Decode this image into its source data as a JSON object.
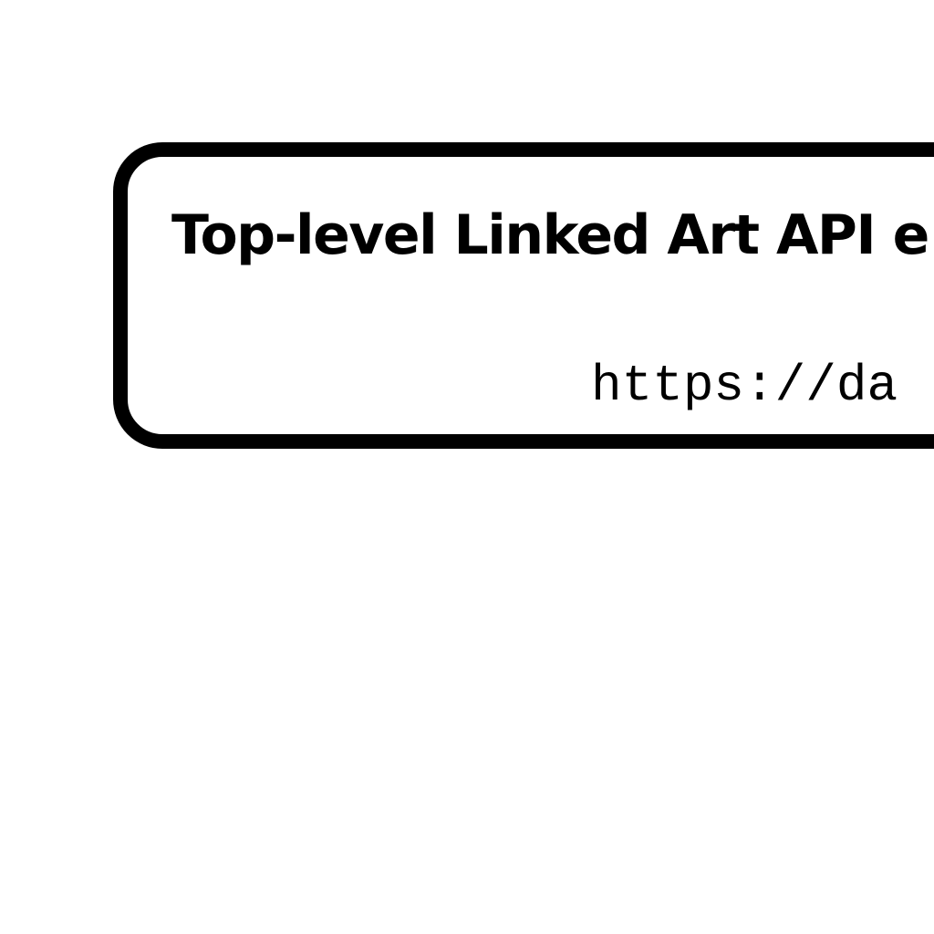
{
  "diagram": {
    "node": {
      "title": "Top-level Linked Art API e",
      "url": "https://da"
    }
  }
}
